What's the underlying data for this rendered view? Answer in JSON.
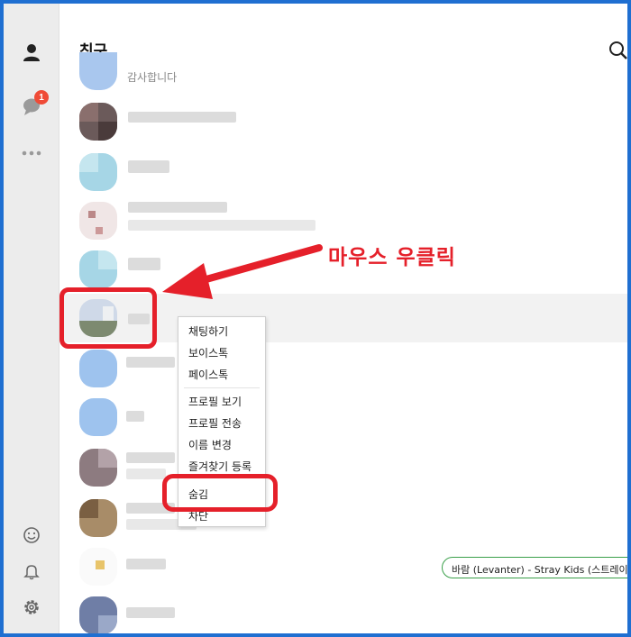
{
  "title": "친구",
  "first_friend_status": "감사합니다",
  "chat_badge": "1",
  "callout": "마우스 우클릭",
  "context_menu": {
    "items": [
      "채팅하기",
      "보이스톡",
      "페이스톡",
      "프로필 보기",
      "프로필 전송",
      "이름 변경",
      "즐겨찾기 등록",
      "숨김",
      "차단"
    ]
  },
  "music_status": "바람 (Levanter) - Stray Kids (스트레이 키즈)",
  "colors": {
    "annotation_red": "#e5202a",
    "frame_blue": "#1f6fd1",
    "badge": "#ef4b37",
    "music_border": "#3aa04a"
  },
  "icons": {
    "rail": [
      "person-icon",
      "chat-icon",
      "more-icon",
      "emoji-icon",
      "bell-icon",
      "settings-icon"
    ],
    "search": "search-icon"
  }
}
